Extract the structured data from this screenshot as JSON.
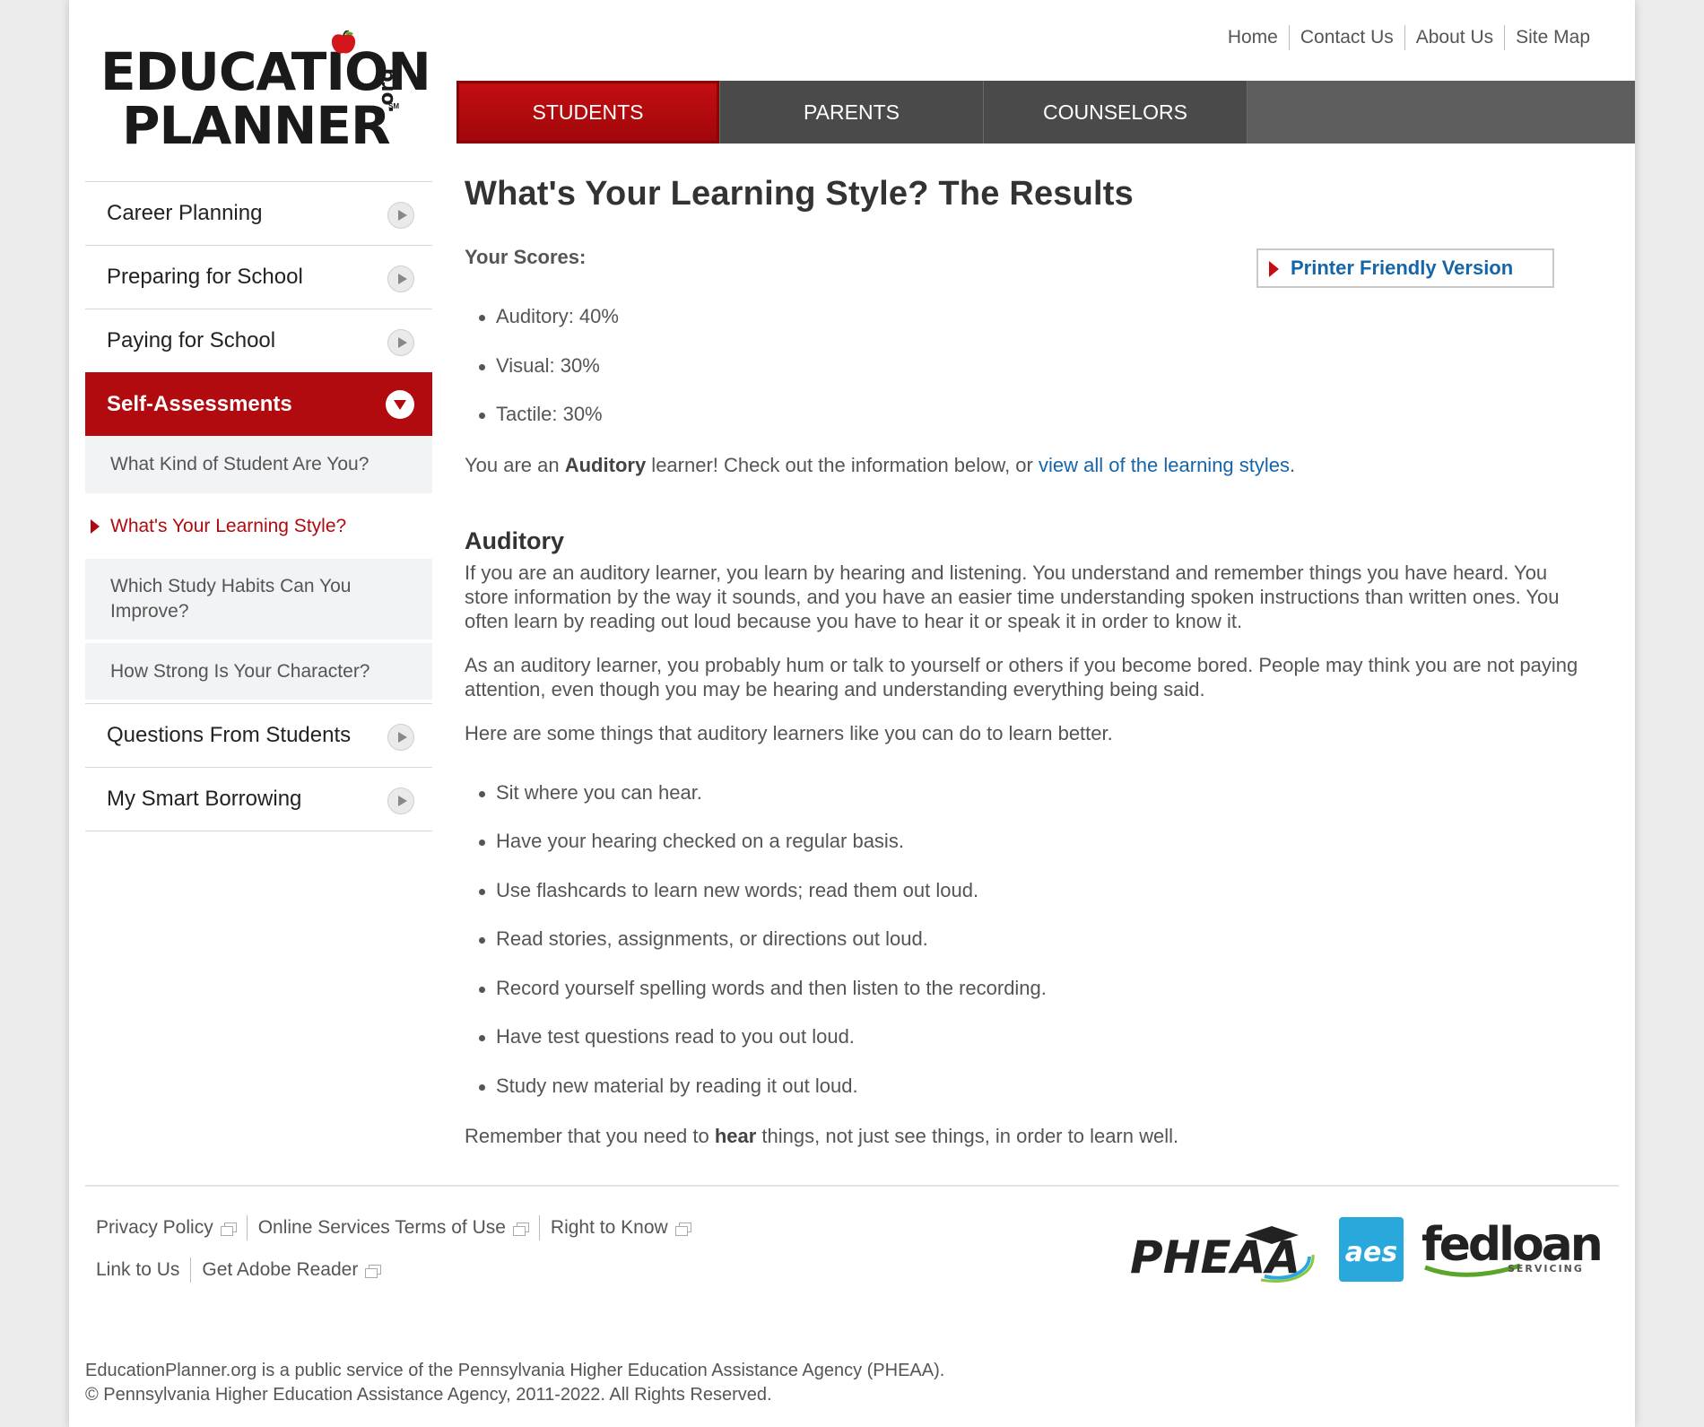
{
  "brand": {
    "logo_line1": "EDUCATION",
    "logo_line2": "PLANNER",
    "logo_suffix": ".org",
    "logo_mark": "SM",
    "accent_color": "#b10a0f",
    "link_color": "#1565a8"
  },
  "utility_nav": [
    "Home",
    "Contact Us",
    "About Us",
    "Site Map"
  ],
  "main_tabs": [
    {
      "label": "STUDENTS",
      "active": true
    },
    {
      "label": "PARENTS",
      "active": false
    },
    {
      "label": "COUNSELORS",
      "active": false
    }
  ],
  "sidebar": {
    "items": [
      {
        "label": "Career Planning",
        "icon": "chevron-right-icon"
      },
      {
        "label": "Preparing for School",
        "icon": "chevron-right-icon"
      },
      {
        "label": "Paying for School",
        "icon": "chevron-right-icon"
      },
      {
        "label": "Self-Assessments",
        "icon": "chevron-down-icon",
        "active": true
      }
    ],
    "sub_items": [
      {
        "label": "What Kind of Student Are You?"
      },
      {
        "label": "What's Your Learning Style?",
        "current": true
      },
      {
        "label": "Which Study Habits Can You Improve?"
      },
      {
        "label": "How Strong Is Your Character?"
      }
    ],
    "items_after": [
      {
        "label": "Questions From Students",
        "icon": "chevron-right-icon"
      },
      {
        "label": "My Smart Borrowing",
        "icon": "chevron-right-icon"
      }
    ]
  },
  "content": {
    "title": "What's Your Learning Style? The Results",
    "scores_label": "Your Scores:",
    "printer_button": "Printer Friendly Version",
    "scores": [
      "Auditory: 40%",
      "Visual: 30%",
      "Tactile: 30%"
    ],
    "intro_pre": "You are an ",
    "intro_bold": "Auditory",
    "intro_mid": " learner! Check out the information below, or ",
    "intro_link": "view all of the learning styles",
    "intro_post": ".",
    "section_title": "Auditory",
    "paragraph1": "If you are an auditory learner, you learn by hearing and listening. You understand and remember things you have heard. You store information by the way it sounds, and you have an easier time understanding spoken instructions than written ones. You often learn by reading out loud because you have to hear it or speak it in order to know it.",
    "paragraph2": "As an auditory learner, you probably hum or talk to yourself or others if you become bored. People may think you are not paying attention, even though you may be hearing and understanding everything being said.",
    "paragraph3": "Here are some things that auditory learners like you can do to learn better.",
    "tips": [
      "Sit where you can hear.",
      "Have your hearing checked on a regular basis.",
      "Use flashcards to learn new words; read them out loud.",
      "Read stories, assignments, or directions out loud.",
      "Record yourself spelling words and then listen to the recording.",
      "Have test questions read to you out loud.",
      "Study new material by reading it out loud."
    ],
    "closing_pre": "Remember that you need to ",
    "closing_bold": "hear",
    "closing_post": " things, not just see things, in order to learn well."
  },
  "footer": {
    "links_row1": [
      "Privacy Policy",
      "Online Services Terms of Use",
      "Right to Know"
    ],
    "links_row2": [
      "Link to Us",
      "Get Adobe Reader"
    ],
    "partners": {
      "pheaa": "PHEAA",
      "aes": "aes",
      "fedloan": "fedloan",
      "fedloan_sub": "SERVICING"
    },
    "legal_line1": "EducationPlanner.org is a public service of the Pennsylvania Higher Education Assistance Agency (PHEAA).",
    "legal_line2": "© Pennsylvania Higher Education Assistance Agency, 2011-2022. All Rights Reserved."
  }
}
